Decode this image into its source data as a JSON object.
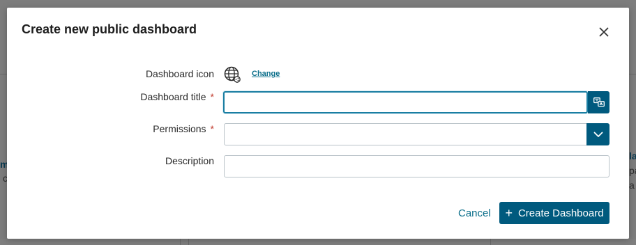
{
  "background": {
    "fragments": [
      "m",
      "c",
      "la",
      "pa",
      "a"
    ]
  },
  "dialog": {
    "title": "Create new public dashboard",
    "close_icon": "close-icon",
    "fields": {
      "icon": {
        "label": "Dashboard icon",
        "icon_name": "globe-icon",
        "change_label": "Change"
      },
      "title": {
        "label": "Dashboard title",
        "required_mark": "*",
        "value": "",
        "addon_icon": "translate-icon"
      },
      "permissions": {
        "label": "Permissions",
        "required_mark": "*",
        "value": "",
        "addon_icon": "chevron-down-icon"
      },
      "description": {
        "label": "Description",
        "value": ""
      }
    },
    "actions": {
      "cancel_label": "Cancel",
      "create_label": "Create Dashboard",
      "create_icon": "plus-icon"
    }
  },
  "colors": {
    "primary": "#005a7e",
    "link": "#0a6e8a",
    "required": "#c0392b",
    "overlay": "#7d7d7d"
  }
}
